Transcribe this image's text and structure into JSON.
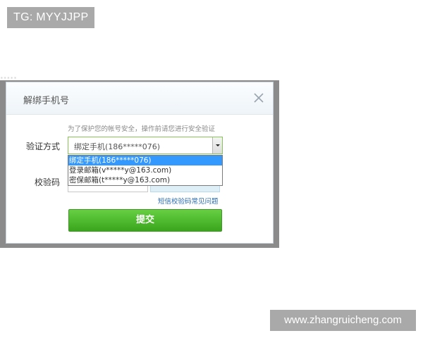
{
  "overlay": {
    "tg_label": "TG: MYYJJPP",
    "website_label": "www.zhangruicheng.com"
  },
  "dialog": {
    "title": "解绑手机号",
    "hint": "为了保护您的帐号安全，操作前请您进行安全验证",
    "method_label": "验证方式",
    "selected_method": "绑定手机(186*****076)",
    "options": [
      "绑定手机(186*****076)",
      "登录邮箱(v*****y@163.com)",
      "密保邮箱(t*****y@163.com)"
    ],
    "code_label": "校验码",
    "help_link": "短信校验码常见问题",
    "submit_label": "提交"
  },
  "colors": {
    "submit_green": "#4cb92b",
    "option_highlight": "#3399ff",
    "link_blue": "#2a6db0",
    "badge_gray": "#a9a9a9"
  }
}
